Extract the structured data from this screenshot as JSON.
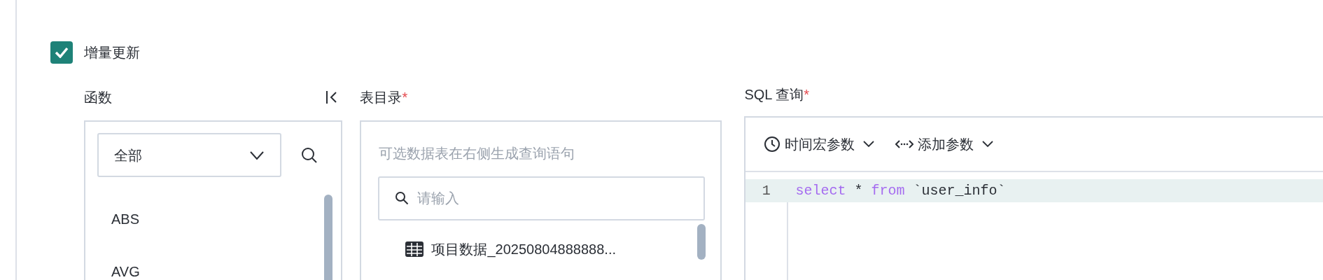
{
  "incremental_update": {
    "label": "增量更新",
    "checked": true
  },
  "functions": {
    "label": "函数",
    "category": "全部",
    "items": [
      "ABS",
      "AVG"
    ]
  },
  "table_catalog": {
    "label": "表目录",
    "required_mark": "*",
    "hint": "可选数据表在右侧生成查询语句",
    "search": {
      "placeholder": "请输入"
    },
    "tables": [
      "项目数据_20250804888888..."
    ]
  },
  "sql_query": {
    "label": "SQL 查询",
    "required_mark": "*",
    "toolbar": [
      {
        "kind": "clock",
        "label": "时间宏参数"
      },
      {
        "kind": "param",
        "label": "添加参数"
      }
    ],
    "lines": [
      {
        "number": "1",
        "active": true,
        "tokens": [
          {
            "kind": "keyword",
            "text": "select"
          },
          {
            "kind": "plain",
            "text": " * "
          },
          {
            "kind": "keyword",
            "text": "from"
          },
          {
            "kind": "plain",
            "text": " `user_info`"
          }
        ]
      }
    ]
  }
}
